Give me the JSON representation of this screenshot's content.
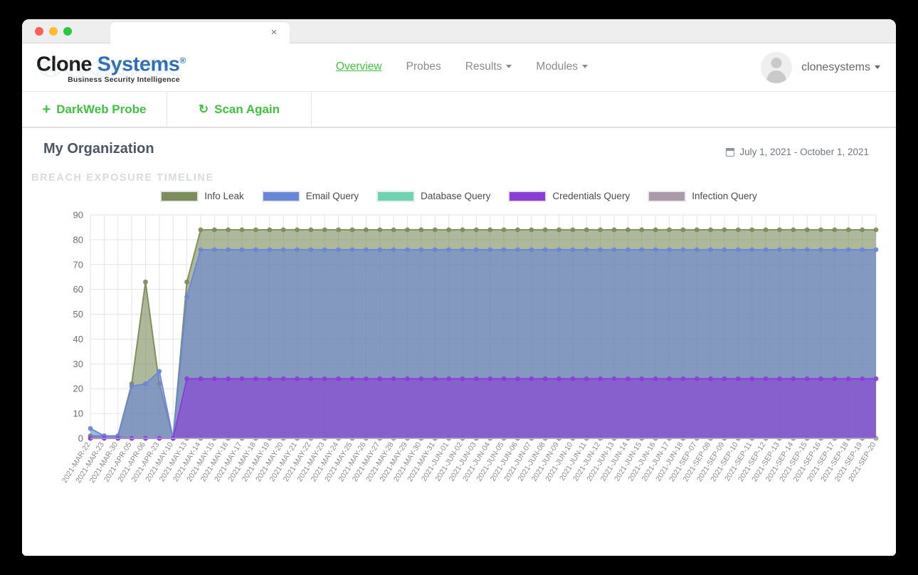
{
  "browser": {
    "traffic_lights": [
      "close",
      "minimize",
      "maximize"
    ],
    "tab_close_label": "×"
  },
  "brand": {
    "name_part1": "Clone",
    "name_part2": "Systems",
    "registered": "®",
    "tagline": "Business Security Intelligence"
  },
  "nav": {
    "items": [
      {
        "label": "Overview",
        "active": true,
        "caret": false
      },
      {
        "label": "Probes",
        "active": false,
        "caret": false
      },
      {
        "label": "Results",
        "active": false,
        "caret": true
      },
      {
        "label": "Modules",
        "active": false,
        "caret": true
      }
    ]
  },
  "user": {
    "name": "clonesystems",
    "avatar_alt": "user-avatar"
  },
  "actions": {
    "darkweb_probe": "DarkWeb Probe",
    "darkweb_icon": "+",
    "scan_again": "Scan Again",
    "scan_icon": "↻"
  },
  "page": {
    "org_title": "My Organization",
    "section_label": "BREACH EXPOSURE TIMELINE",
    "date_range": "July 1, 2021 - October 1, 2021"
  },
  "colors": {
    "accent_green": "#3fc23f",
    "info_leak": "#7d8c5c",
    "email_query": "#6a86d6",
    "database_query": "#6ed3ae",
    "credentials_query": "#8a3ed6",
    "infection_query": "#ac9aaa",
    "grid": "#e3e3e3",
    "axis_text": "#6d6d6d"
  },
  "chart_data": {
    "type": "area",
    "title": "BREACH EXPOSURE TIMELINE",
    "xlabel": "",
    "ylabel": "",
    "ylim": [
      0,
      90
    ],
    "yticks": [
      0,
      10,
      20,
      30,
      40,
      50,
      60,
      70,
      80,
      90
    ],
    "grid": true,
    "legend_position": "top-center",
    "stacked": false,
    "categories": [
      "2021-MAR-22",
      "2021-MAR-23",
      "2021-MAR-30",
      "2021-APR-05",
      "2021-APR-06",
      "2021-APR-23",
      "2021-MAY-10",
      "2021-MAY-13",
      "2021-MAY-14",
      "2021-MAY-15",
      "2021-MAY-16",
      "2021-MAY-17",
      "2021-MAY-18",
      "2021-MAY-19",
      "2021-MAY-20",
      "2021-MAY-21",
      "2021-MAY-22",
      "2021-MAY-23",
      "2021-MAY-24",
      "2021-MAY-25",
      "2021-MAY-26",
      "2021-MAY-27",
      "2021-MAY-28",
      "2021-MAY-29",
      "2021-MAY-30",
      "2021-MAY-31",
      "2021-JUN-01",
      "2021-JUN-02",
      "2021-JUN-03",
      "2021-JUN-04",
      "2021-JUN-05",
      "2021-JUN-06",
      "2021-JUN-07",
      "2021-JUN-08",
      "2021-JUN-09",
      "2021-JUN-10",
      "2021-JUN-11",
      "2021-JUN-12",
      "2021-JUN-13",
      "2021-JUN-14",
      "2021-JUN-15",
      "2021-JUN-16",
      "2021-JUN-17",
      "2021-JUN-18",
      "2021-SEP-07",
      "2021-SEP-08",
      "2021-SEP-09",
      "2021-SEP-10",
      "2021-SEP-11",
      "2021-SEP-12",
      "2021-SEP-13",
      "2021-SEP-14",
      "2021-SEP-15",
      "2021-SEP-16",
      "2021-SEP-17",
      "2021-SEP-18",
      "2021-SEP-19",
      "2021-SEP-20"
    ],
    "series": [
      {
        "name": "Info Leak",
        "color": "#7d8c5c",
        "values": [
          1,
          1,
          1,
          22,
          63,
          22,
          0,
          63,
          84,
          84,
          84,
          84,
          84,
          84,
          84,
          84,
          84,
          84,
          84,
          84,
          84,
          84,
          84,
          84,
          84,
          84,
          84,
          84,
          84,
          84,
          84,
          84,
          84,
          84,
          84,
          84,
          84,
          84,
          84,
          84,
          84,
          84,
          84,
          84,
          84,
          84,
          84,
          84,
          84,
          84,
          84,
          84,
          84,
          84,
          84,
          84,
          84,
          84
        ]
      },
      {
        "name": "Email Query",
        "color": "#6a86d6",
        "values": [
          4,
          1,
          1,
          21,
          22,
          27,
          0,
          57,
          76,
          76,
          76,
          76,
          76,
          76,
          76,
          76,
          76,
          76,
          76,
          76,
          76,
          76,
          76,
          76,
          76,
          76,
          76,
          76,
          76,
          76,
          76,
          76,
          76,
          76,
          76,
          76,
          76,
          76,
          76,
          76,
          76,
          76,
          76,
          76,
          76,
          76,
          76,
          76,
          76,
          76,
          76,
          76,
          76,
          76,
          76,
          76,
          76,
          76
        ]
      },
      {
        "name": "Database Query",
        "color": "#6ed3ae",
        "values": [
          1,
          0,
          0,
          0,
          0,
          0,
          0,
          0,
          0,
          0,
          0,
          0,
          0,
          0,
          0,
          0,
          0,
          0,
          0,
          0,
          0,
          0,
          0,
          0,
          0,
          0,
          0,
          0,
          0,
          0,
          0,
          0,
          0,
          0,
          0,
          0,
          0,
          0,
          0,
          0,
          0,
          0,
          0,
          0,
          0,
          0,
          0,
          0,
          0,
          0,
          0,
          0,
          0,
          0,
          0,
          0,
          0,
          0
        ]
      },
      {
        "name": "Credentials Query",
        "color": "#8a3ed6",
        "values": [
          0,
          0,
          0,
          0,
          0,
          0,
          0,
          24,
          24,
          24,
          24,
          24,
          24,
          24,
          24,
          24,
          24,
          24,
          24,
          24,
          24,
          24,
          24,
          24,
          24,
          24,
          24,
          24,
          24,
          24,
          24,
          24,
          24,
          24,
          24,
          24,
          24,
          24,
          24,
          24,
          24,
          24,
          24,
          24,
          24,
          24,
          24,
          24,
          24,
          24,
          24,
          24,
          24,
          24,
          24,
          24,
          24,
          24
        ]
      },
      {
        "name": "Infection Query",
        "color": "#ac9aaa",
        "values": [
          0,
          1,
          1,
          0,
          0,
          0,
          0,
          0,
          0,
          0,
          0,
          0,
          0,
          0,
          0,
          0,
          0,
          0,
          0,
          0,
          0,
          0,
          0,
          0,
          0,
          0,
          0,
          0,
          0,
          0,
          0,
          0,
          0,
          0,
          0,
          0,
          0,
          0,
          0,
          0,
          0,
          0,
          0,
          0,
          0,
          0,
          0,
          0,
          0,
          0,
          0,
          0,
          0,
          0,
          0,
          0,
          0,
          0
        ]
      }
    ]
  }
}
